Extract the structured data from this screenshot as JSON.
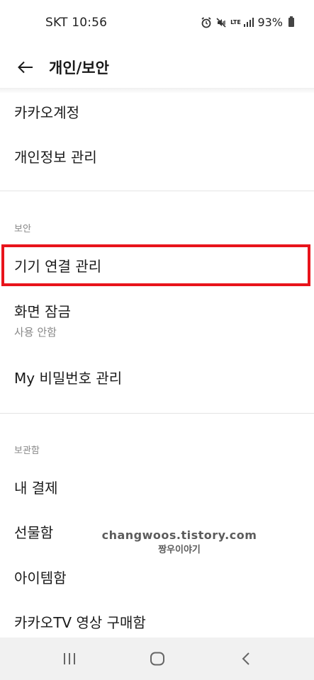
{
  "status_bar": {
    "carrier_time": "SKT 10:56",
    "lte_label": "LTE",
    "battery_percent": "93%",
    "icons": [
      "alarm-icon",
      "mute-vibrate-icon",
      "lte-icon",
      "signal-icon",
      "battery-icon"
    ]
  },
  "header": {
    "back_icon": "arrow-left-icon",
    "title": "개인/보안"
  },
  "account_items": [
    {
      "label": "카카오계정"
    },
    {
      "label": "개인정보 관리"
    }
  ],
  "security": {
    "section_title": "보안",
    "items": [
      {
        "label": "기기 연결 관리"
      },
      {
        "label": "화면 잠금",
        "sub": "사용 안함"
      },
      {
        "label": "My 비밀번호 관리"
      }
    ]
  },
  "storage": {
    "section_title": "보관함",
    "items": [
      {
        "label": "내 결제"
      },
      {
        "label": "선물함"
      },
      {
        "label": "아이템함"
      },
      {
        "label": "카카오TV 영상 구매함"
      }
    ]
  },
  "watermark": {
    "line1": "changwoos.tistory.com",
    "line2": "짱우이야기"
  },
  "colors": {
    "highlight_border": "#e8141b",
    "divider": "#e4e4e4",
    "nav_bar_bg": "#f1f1f1",
    "secondary_text": "#888888"
  },
  "nav_bar": {
    "icons": [
      "recent-apps-icon",
      "home-icon",
      "back-nav-icon"
    ]
  }
}
